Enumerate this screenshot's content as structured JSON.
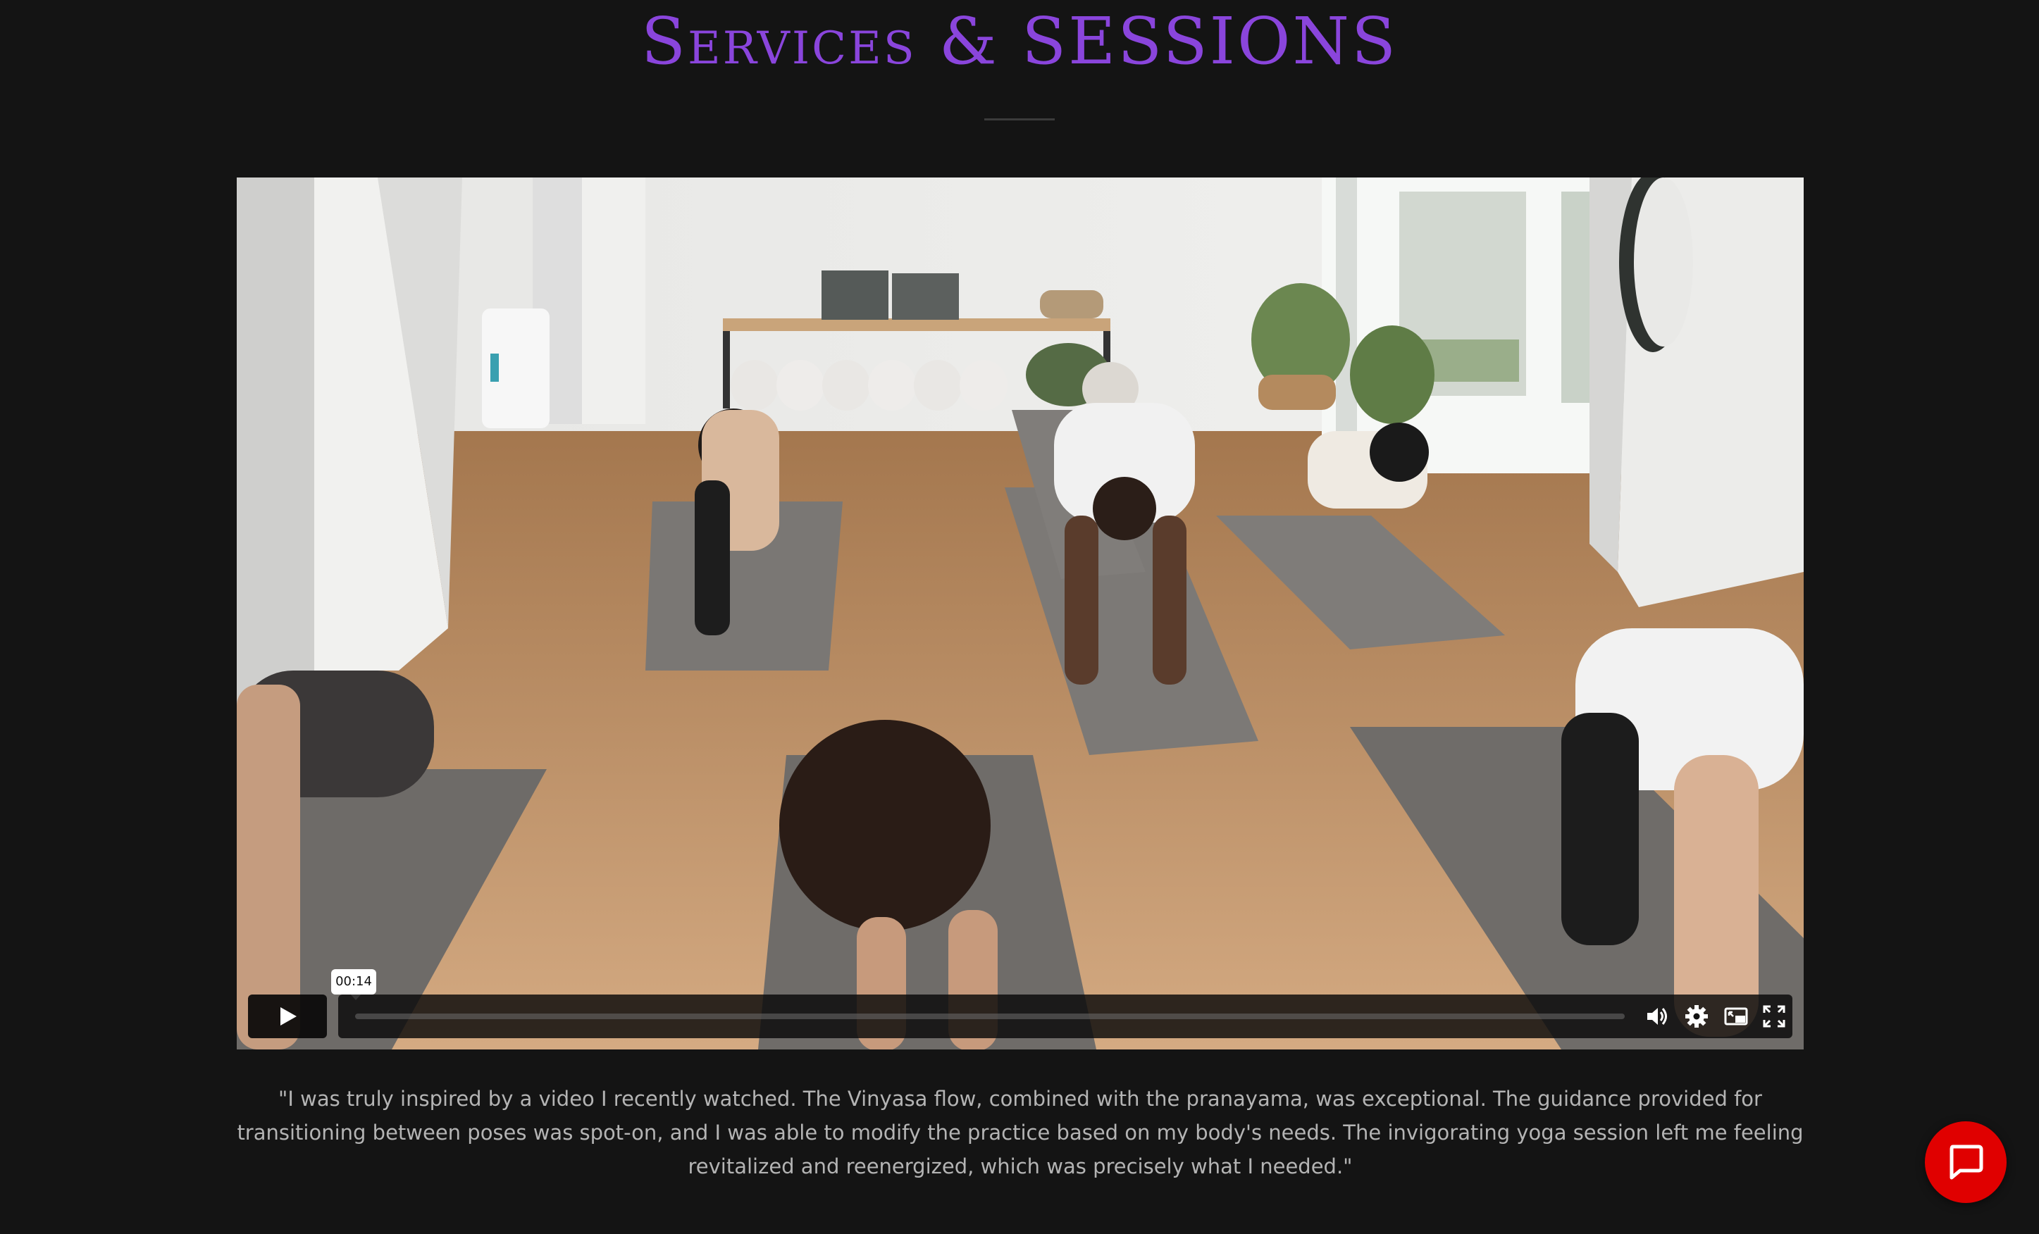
{
  "page": {
    "title": "Services & SESSIONS"
  },
  "video": {
    "hover_time": "00:14",
    "progress": 0,
    "controls": {
      "play_icon": "play-icon",
      "volume_icon": "volume-icon",
      "settings_icon": "gear-icon",
      "pip_icon": "picture-in-picture-icon",
      "fullscreen_icon": "fullscreen-icon"
    }
  },
  "testimonial": {
    "text": "\"I was truly inspired by a video I recently watched. The Vinyasa flow, combined with the pranayama, was exceptional. The guidance provided for transitioning between poses was spot-on, and I was able to modify the practice based on my body's needs. The invigorating yoga session left me feeling revitalized and reenergized, which was precisely what I needed.\""
  },
  "chat": {
    "icon": "chat-bubble-icon"
  },
  "colors": {
    "background": "#141414",
    "title": "#8a45dc",
    "chat_button": "#e00000",
    "quote_text": "#b4b4b4"
  }
}
